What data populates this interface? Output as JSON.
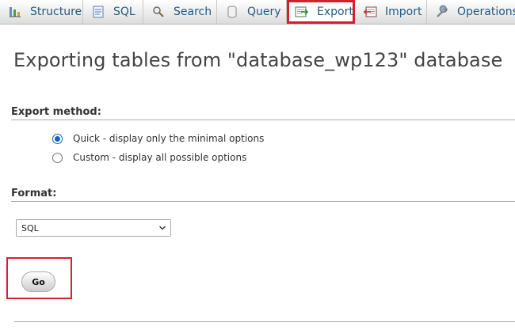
{
  "tabs": [
    {
      "label": "Structure",
      "icon": "structure-icon",
      "active": false
    },
    {
      "label": "SQL",
      "icon": "sql-icon",
      "active": false
    },
    {
      "label": "Search",
      "icon": "search-icon",
      "active": false
    },
    {
      "label": "Query",
      "icon": "query-icon",
      "active": false
    },
    {
      "label": "Export",
      "icon": "export-icon",
      "active": true
    },
    {
      "label": "Import",
      "icon": "import-icon",
      "active": false
    },
    {
      "label": "Operations",
      "icon": "operations-icon",
      "active": false
    }
  ],
  "page": {
    "title": "Exporting tables from \"database_wp123\" database"
  },
  "export_method": {
    "heading": "Export method:",
    "options": [
      {
        "label": "Quick - display only the minimal options",
        "checked": true
      },
      {
        "label": "Custom - display all possible options",
        "checked": false
      }
    ]
  },
  "format": {
    "heading": "Format:",
    "selected": "SQL"
  },
  "actions": {
    "go_label": "Go"
  },
  "colors": {
    "tab_text": "#235a81",
    "highlight_red": "#d4212b",
    "radio_blue": "#0a66c2"
  }
}
